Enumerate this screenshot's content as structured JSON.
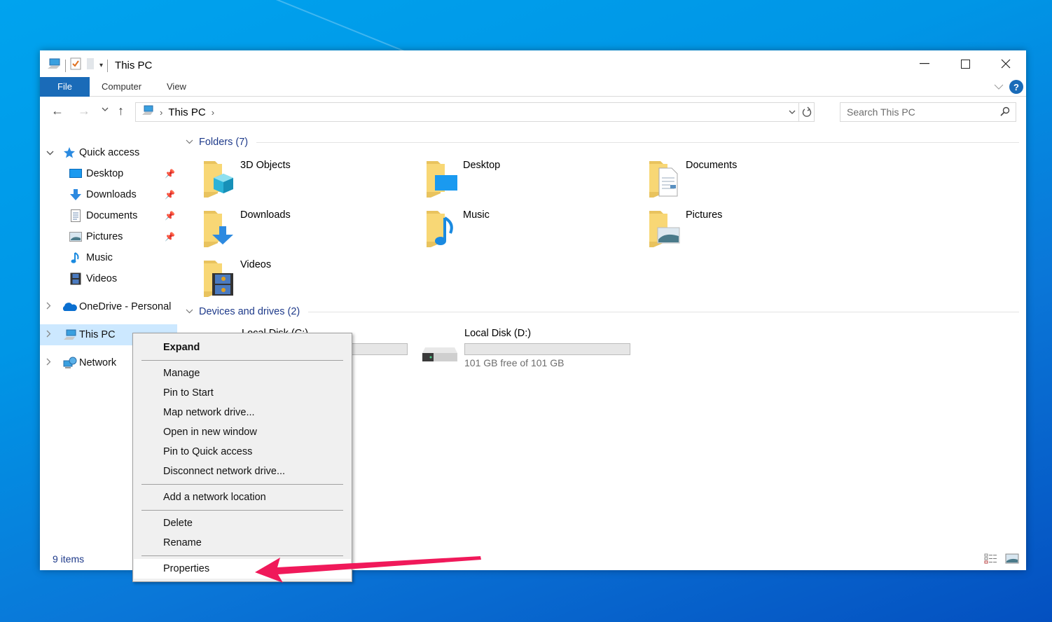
{
  "window": {
    "title": "This PC",
    "controls": {
      "minimize": "—",
      "maximize": "☐",
      "close": "✕"
    }
  },
  "ribbon": {
    "tabs": [
      {
        "label": "File",
        "active": true
      },
      {
        "label": "Computer",
        "active": false
      },
      {
        "label": "View",
        "active": false
      }
    ],
    "help": "?"
  },
  "navbar": {
    "back": "←",
    "forward": "→",
    "recent": "⌄",
    "up": "↑",
    "breadcrumb": [
      "This PC"
    ],
    "search_placeholder": "Search This PC"
  },
  "sidebar": {
    "quick_access": {
      "label": "Quick access",
      "items": [
        {
          "label": "Desktop",
          "icon": "desktop-icon",
          "pinned": true
        },
        {
          "label": "Downloads",
          "icon": "downloads-icon",
          "pinned": true
        },
        {
          "label": "Documents",
          "icon": "documents-icon",
          "pinned": true
        },
        {
          "label": "Pictures",
          "icon": "pictures-icon",
          "pinned": true
        },
        {
          "label": "Music",
          "icon": "music-icon",
          "pinned": false
        },
        {
          "label": "Videos",
          "icon": "videos-icon",
          "pinned": false
        }
      ]
    },
    "onedrive": "OneDrive - Personal",
    "this_pc": "This PC",
    "network": "Network"
  },
  "content": {
    "folders_header": "Folders (7)",
    "folders": [
      {
        "label": "3D Objects",
        "icon": "3d-objects-icon"
      },
      {
        "label": "Desktop",
        "icon": "desktop-icon"
      },
      {
        "label": "Documents",
        "icon": "documents-icon"
      },
      {
        "label": "Downloads",
        "icon": "downloads-icon"
      },
      {
        "label": "Music",
        "icon": "music-icon"
      },
      {
        "label": "Pictures",
        "icon": "pictures-icon"
      },
      {
        "label": "Videos",
        "icon": "videos-icon"
      }
    ],
    "drives_header": "Devices and drives (2)",
    "drives": [
      {
        "label": "Local Disk (C:)",
        "free_text": "",
        "used_fraction": 0
      },
      {
        "label": "Local Disk (D:)",
        "free_text": "101 GB free of 101 GB",
        "used_fraction": 0
      }
    ]
  },
  "status": {
    "items": "9 items"
  },
  "context_menu": {
    "items": [
      {
        "label": "Expand",
        "bold": true
      },
      {
        "label": "Manage"
      },
      {
        "label": "Pin to Start"
      },
      {
        "label": "Map network drive..."
      },
      {
        "label": "Open in new window"
      },
      {
        "label": "Pin to Quick access"
      },
      {
        "label": "Disconnect network drive..."
      },
      {
        "label": "Add a network location"
      },
      {
        "label": "Delete"
      },
      {
        "label": "Rename"
      },
      {
        "label": "Properties",
        "highlighted": true
      }
    ]
  },
  "annotation": {
    "arrow_color": "#f0195a",
    "points_to": "Properties"
  }
}
